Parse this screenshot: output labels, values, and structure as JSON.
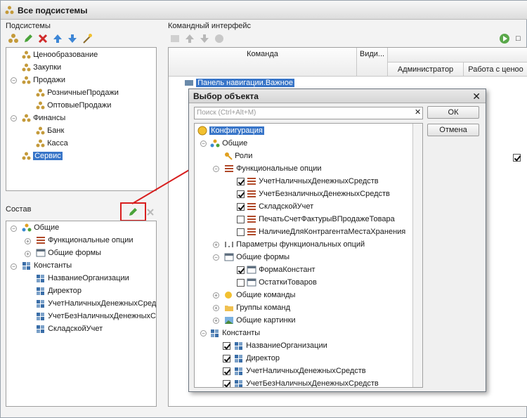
{
  "window": {
    "title": "Все подсистемы"
  },
  "subsystems": {
    "label": "Подсистемы",
    "items": [
      {
        "label": "Ценообразование"
      },
      {
        "label": "Закупки"
      },
      {
        "label": "Продажи"
      },
      {
        "label": "РозничныеПродажи"
      },
      {
        "label": "ОптовыеПродажи"
      },
      {
        "label": "Финансы"
      },
      {
        "label": "Банк"
      },
      {
        "label": "Касса"
      },
      {
        "label": "Сервис"
      }
    ]
  },
  "composition": {
    "label": "Состав",
    "items": [
      {
        "label": "Общие"
      },
      {
        "label": "Функциональные опции"
      },
      {
        "label": "Общие формы"
      },
      {
        "label": "Константы"
      },
      {
        "label": "НазваниеОрганизации"
      },
      {
        "label": "Директор"
      },
      {
        "label": "УчетНаличныхДенежныхСредств"
      },
      {
        "label": "УчетБезНаличныхДенежныхСредств"
      },
      {
        "label": "СкладскойУчет"
      }
    ]
  },
  "command_interface": {
    "label": "Командный интерфейс",
    "columns": [
      "Команда",
      "Види...",
      "Администратор",
      "Работа с ценоо"
    ],
    "rows": [
      {
        "label": "Панель навигации.Важное"
      }
    ]
  },
  "dialog": {
    "title": "Выбор объекта",
    "search_placeholder": "Поиск (Ctrl+Alt+M)",
    "ok": "ОК",
    "cancel": "Отмена",
    "tree": [
      {
        "label": "Конфигурация"
      },
      {
        "label": "Общие"
      },
      {
        "label": "Роли"
      },
      {
        "label": "Функциональные опции"
      },
      {
        "label": "УчетНаличныхДенежныхСредств",
        "checked": true
      },
      {
        "label": "УчетБезналичныхДенежныхСредств",
        "checked": true
      },
      {
        "label": "СкладскойУчет",
        "checked": true
      },
      {
        "label": "ПечатьСчетФактурыВПродажеТовара",
        "checked": false
      },
      {
        "label": "НаличиеДляКонтрагентаМестаХранения",
        "checked": false
      },
      {
        "label": "Параметры функциональных опций"
      },
      {
        "label": "Общие формы"
      },
      {
        "label": "ФормаКонстант",
        "checked": true
      },
      {
        "label": "ОстаткиТоваров",
        "checked": false
      },
      {
        "label": "Общие команды"
      },
      {
        "label": "Группы команд"
      },
      {
        "label": "Общие картинки"
      },
      {
        "label": "Константы"
      },
      {
        "label": "НазваниеОрганизации",
        "checked": true
      },
      {
        "label": "Директор",
        "checked": true
      },
      {
        "label": "УчетНаличныхДенежныхСредств",
        "checked": true
      },
      {
        "label": "УчетБезНаличныхДенежныхСредств",
        "checked": true
      }
    ]
  },
  "colors": {
    "selection": "#3875c8",
    "highlight": "#d81f1f"
  }
}
